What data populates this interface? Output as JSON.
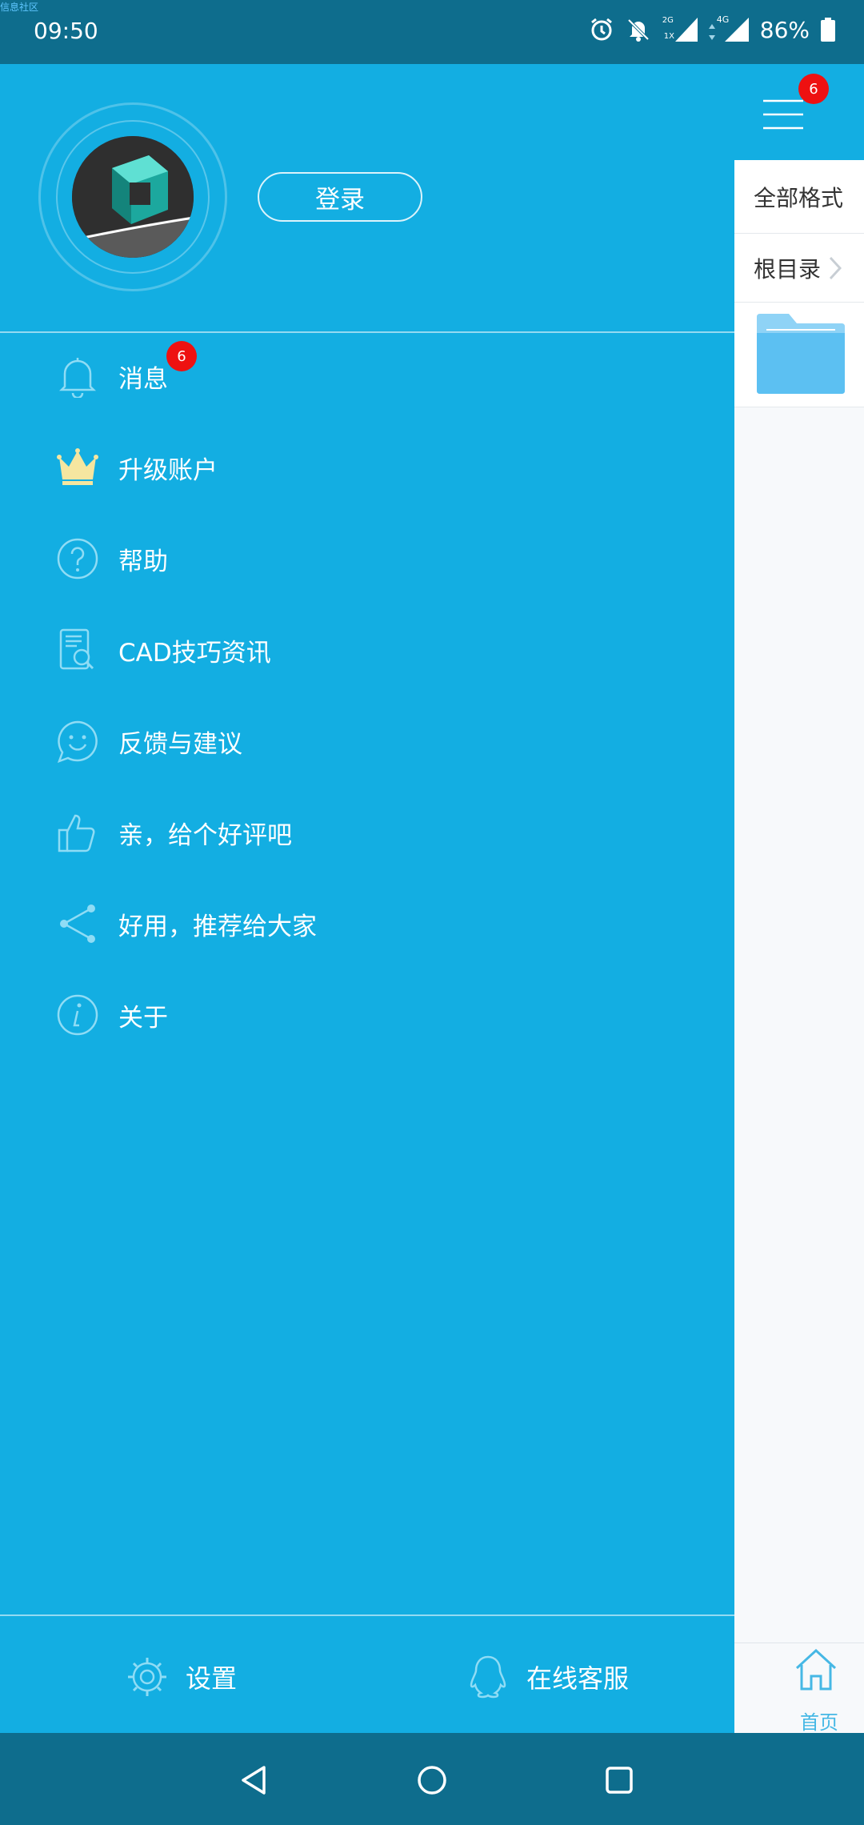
{
  "watermark": "信息社区",
  "status": {
    "time": "09:50",
    "sim_label_top": "2G",
    "sim_label_bottom": "1X",
    "network": "4G",
    "battery": "86%"
  },
  "header": {
    "menu_badge": "6",
    "login_label": "登录"
  },
  "menu": {
    "items": [
      {
        "label": "消息",
        "icon": "bell-icon",
        "badge": "6"
      },
      {
        "label": "升级账户",
        "icon": "crown-icon"
      },
      {
        "label": "帮助",
        "icon": "help-icon"
      },
      {
        "label": "CAD技巧资讯",
        "icon": "doc-search-icon"
      },
      {
        "label": "反馈与建议",
        "icon": "chat-smile-icon"
      },
      {
        "label": "亲，给个好评吧",
        "icon": "thumbs-up-icon"
      },
      {
        "label": "好用，推荐给大家",
        "icon": "share-icon"
      },
      {
        "label": "关于",
        "icon": "info-icon"
      }
    ]
  },
  "footer": {
    "settings_label": "设置",
    "support_label": "在线客服"
  },
  "right_panel": {
    "filter_label": "全部格式",
    "path_label": "根目录",
    "home_label": "首页"
  },
  "colors": {
    "drawer": "#13aee2",
    "statusbar": "#0e6d8d",
    "badge": "#ee1111",
    "crown": "#f5e6a0"
  }
}
